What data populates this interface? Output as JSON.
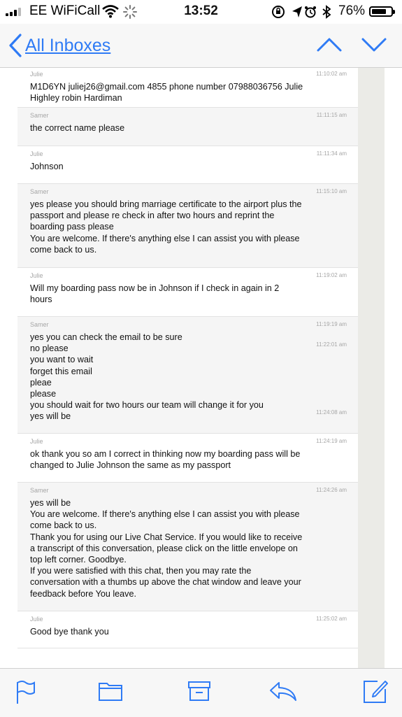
{
  "status_bar": {
    "carrier": "EE WiFiCall",
    "time": "13:52",
    "battery": "76%",
    "battery_level": 0.76
  },
  "nav": {
    "back_label": "All Inboxes"
  },
  "messages": [
    {
      "sender": "Julie",
      "alt": false,
      "height": 59,
      "times": [
        {
          "t": "11:10:02 am",
          "row": 0
        }
      ],
      "lines": [
        "M1D6YN juliej26@gmail.com 4855 phone number 07988036756 Julie",
        "Highley robin Hardiman"
      ]
    },
    {
      "sender": "Samer",
      "alt": true,
      "height": 55,
      "times": [
        {
          "t": "11:11:15 am",
          "row": 0
        }
      ],
      "lines": [
        "the correct name please"
      ]
    },
    {
      "sender": "Julie",
      "alt": false,
      "height": 54,
      "times": [
        {
          "t": "11:11:34 am",
          "row": 0
        }
      ],
      "lines": [
        "Johnson"
      ]
    },
    {
      "sender": "Samer",
      "alt": true,
      "height": 120,
      "times": [
        {
          "t": "11:15:10 am",
          "row": 0
        }
      ],
      "lines": [
        "yes please you should bring marriage certificate to the airport plus the",
        "passport and please re check in after two hours and reprint the",
        "boarding pass please",
        "You are welcome. If there's anything else I can assist you with please",
        "come back to us."
      ]
    },
    {
      "sender": "Julie",
      "alt": false,
      "height": 70,
      "times": [
        {
          "t": "11:19:02 am",
          "row": 0
        }
      ],
      "lines": [
        "Will my boarding pass now be in Johnson if I check in again in 2",
        "hours"
      ]
    },
    {
      "sender": "Samer",
      "alt": true,
      "height": 167,
      "times": [
        {
          "t": "11:19:19 am",
          "row": 0
        },
        {
          "t": "11:22:01 am",
          "row": 1
        },
        {
          "t": "11:24:08 am",
          "row": 7
        }
      ],
      "lines": [
        "yes you can check the email to be sure",
        "no please",
        "you want to wait",
        "forget this email",
        "pleae",
        "please",
        "you should wait for two hours our team will change it for you",
        "yes will be"
      ]
    },
    {
      "sender": "Julie",
      "alt": false,
      "height": 70,
      "times": [
        {
          "t": "11:24:19 am",
          "row": 0
        }
      ],
      "lines": [
        "ok thank you so am I correct in thinking now my boarding pass will be",
        "changed to Julie Johnson the same as my passport"
      ]
    },
    {
      "sender": "Samer",
      "alt": true,
      "height": 184,
      "times": [
        {
          "t": "11:24:26 am",
          "row": 0
        }
      ],
      "lines": [
        "yes will be",
        "You are welcome. If there's anything else I can assist you with please",
        "come back to us.",
        "Thank you for using our Live Chat Service. If you would like to receive",
        "a transcript of this conversation, please click on the little envelope on",
        "top left corner. Goodbye.",
        "If you were satisfied with this chat, then you may rate the",
        "conversation with a thumbs up above the chat window and leave your",
        "feedback before You leave."
      ]
    },
    {
      "sender": "Julie",
      "alt": false,
      "height": 53,
      "times": [
        {
          "t": "11:25:02 am",
          "row": 0
        }
      ],
      "lines": [
        "Good bye thank you"
      ]
    }
  ],
  "icons": {
    "back": "chevron-left-icon",
    "prev": "chevron-up-icon",
    "next": "chevron-down-icon",
    "flag": "flag-icon",
    "folder": "folder-icon",
    "archive": "archive-box-icon",
    "reply": "reply-arrow-icon",
    "compose": "compose-icon"
  },
  "colors": {
    "accent": "#2f7bf5",
    "meta_text": "#a6a6a6",
    "alt_row": "#f5f5f5"
  }
}
